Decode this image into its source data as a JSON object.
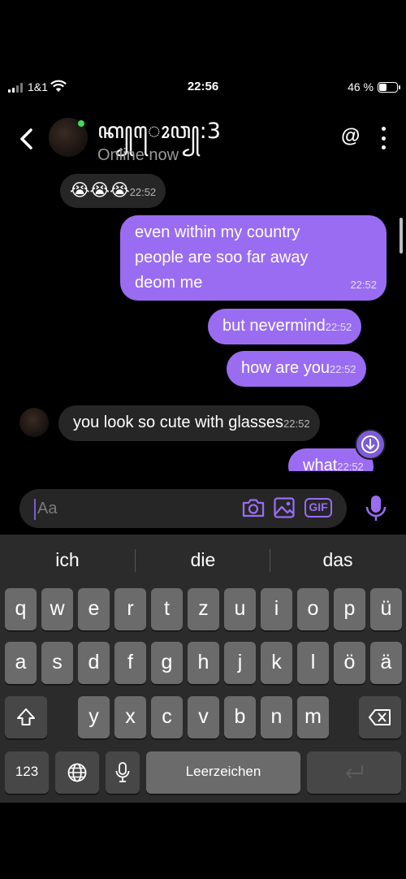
{
  "status_bar": {
    "carrier": "1&1",
    "time": "22:56",
    "battery_percent_label": "46 %",
    "battery_level": 0.46
  },
  "header": {
    "contact_name": "ꦏ꧀ꦺꦴꦮ꧀:3",
    "presence": "Online now",
    "at_label": "@"
  },
  "messages": [
    {
      "direction": "in",
      "text": "😭😭😭",
      "time": "22:52"
    },
    {
      "direction": "out",
      "lines": [
        "even within my country",
        "people are soo far away",
        "deom me"
      ],
      "time": "22:52"
    },
    {
      "direction": "out",
      "text": "but nevermind",
      "time": "22:52"
    },
    {
      "direction": "out",
      "text": "how are you",
      "time": "22:52"
    },
    {
      "direction": "in",
      "text": "you look so cute with glasses",
      "time": "22:52"
    },
    {
      "direction": "out",
      "text": "what",
      "time": "22:52"
    }
  ],
  "composer": {
    "placeholder": "Aa",
    "gif_label": "GIF"
  },
  "keyboard": {
    "suggestions": [
      "ich",
      "die",
      "das"
    ],
    "row1": [
      "q",
      "w",
      "e",
      "r",
      "t",
      "z",
      "u",
      "i",
      "o",
      "p",
      "ü"
    ],
    "row2": [
      "a",
      "s",
      "d",
      "f",
      "g",
      "h",
      "j",
      "k",
      "l",
      "ö",
      "ä"
    ],
    "row3": [
      "y",
      "x",
      "c",
      "v",
      "b",
      "n",
      "m"
    ],
    "numbers_label": "123",
    "space_label": "Leerzeichen"
  },
  "colors": {
    "accent": "#9a6cf2",
    "incoming_bubble": "#262626",
    "online": "#3ddc52"
  }
}
